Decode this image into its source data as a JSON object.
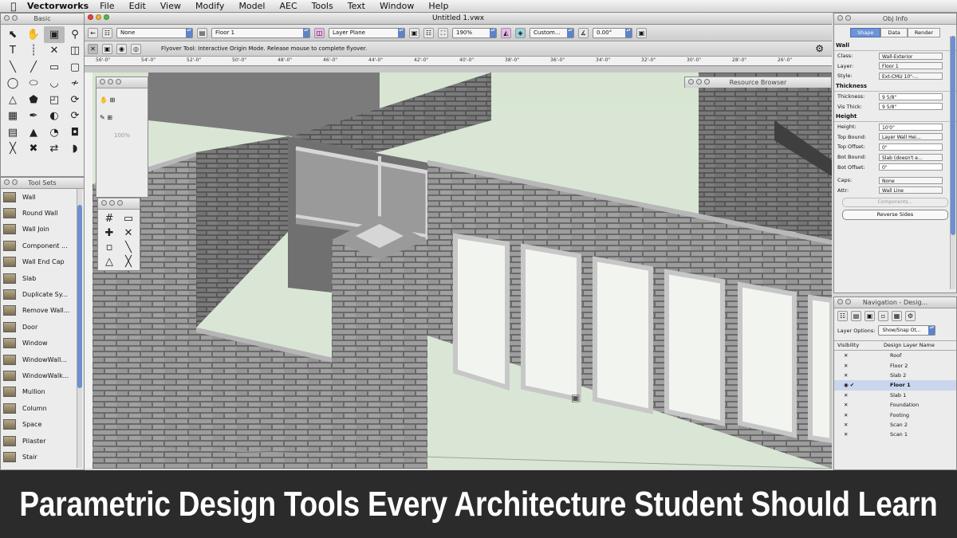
{
  "menubar": {
    "apple_icon": "apple-icon",
    "app_name": "Vectorworks",
    "items": [
      "File",
      "Edit",
      "View",
      "Modify",
      "Model",
      "AEC",
      "Tools",
      "Text",
      "Window",
      "Help"
    ]
  },
  "basic_palette": {
    "title": "Basic"
  },
  "tool_sets": {
    "title": "Tool Sets",
    "items": [
      {
        "label": "Wall",
        "icon": "wall-icon"
      },
      {
        "label": "Round Wall",
        "icon": "round-wall-icon"
      },
      {
        "label": "Wall Join",
        "icon": "wall-join-icon"
      },
      {
        "label": "Component ...",
        "icon": "component-icon"
      },
      {
        "label": "Wall End Cap",
        "icon": "wall-end-cap-icon"
      },
      {
        "label": "Slab",
        "icon": "slab-icon"
      },
      {
        "label": "Duplicate Sy...",
        "icon": "duplicate-symbol-icon"
      },
      {
        "label": "Remove Wall...",
        "icon": "remove-wall-icon"
      },
      {
        "label": "Door",
        "icon": "door-icon"
      },
      {
        "label": "Window",
        "icon": "window-icon"
      },
      {
        "label": "WindowWall...",
        "icon": "window-wall-icon"
      },
      {
        "label": "WindowWalk...",
        "icon": "window-walk-icon"
      },
      {
        "label": "Mullion",
        "icon": "mullion-icon"
      },
      {
        "label": "Column",
        "icon": "column-icon"
      },
      {
        "label": "Space",
        "icon": "space-icon"
      },
      {
        "label": "Pilaster",
        "icon": "pilaster-icon"
      },
      {
        "label": "Stair",
        "icon": "stair-icon"
      }
    ]
  },
  "document": {
    "title": "Untitled 1.vwx",
    "class_value": "None",
    "layer_value": "Floor 1",
    "layer_plane": "Layer Plane",
    "zoom": "190%",
    "view_value": "Custom...",
    "angle": "0.00°",
    "mode_text": "Flyover Tool: Interactive Origin Mode. Release mouse to complete flyover.",
    "ruler_ticks": [
      "56'-0\"",
      "54'-0\"",
      "52'-0\"",
      "50'-0\"",
      "48'-0\"",
      "46'-0\"",
      "44'-0\"",
      "42'-0\"",
      "40'-0\"",
      "38'-0\"",
      "36'-0\"",
      "34'-0\"",
      "32'-0\"",
      "30'-0\"",
      "28'-0\"",
      "26'-0\""
    ]
  },
  "resource_browser": {
    "title": "Resource Browser"
  },
  "floating_palette": {
    "zoom_value": "100%"
  },
  "obj_info": {
    "title": "Obj Info",
    "tabs": [
      "Shape",
      "Data",
      "Render"
    ],
    "object_type": "Wall",
    "rows": [
      {
        "label": "Class:",
        "value": "Wall-Exterior"
      },
      {
        "label": "Layer:",
        "value": "Floor 1"
      },
      {
        "label": "Style:",
        "value": "Ext-CMU 10\"-..."
      }
    ],
    "thickness_section": "Thickness",
    "thickness_rows": [
      {
        "label": "Thickness:",
        "value": "9 5/8\""
      },
      {
        "label": "Vis Thick:",
        "value": "9 5/8\""
      }
    ],
    "height_section": "Height",
    "height_rows": [
      {
        "label": "Height:",
        "value": "10'0\""
      },
      {
        "label": "Top Bound:",
        "value": "Layer Wall Hei..."
      },
      {
        "label": "Top Offset:",
        "value": "0\""
      },
      {
        "label": "Bot Bound:",
        "value": "Slab (doesn't e..."
      },
      {
        "label": "Bot Offset:",
        "value": "0\""
      }
    ],
    "caps_rows": [
      {
        "label": "Caps:",
        "value": "None"
      },
      {
        "label": "Attr:",
        "value": "Wall Line"
      }
    ],
    "components_button": "Components...",
    "reverse_sides_button": "Reverse Sides"
  },
  "navigation": {
    "title": "Navigation - Desig...",
    "layer_options_label": "Layer Options:",
    "layer_options_value": "Show/Snap Ot...",
    "col_visibility": "Visibility",
    "col_layer": "Design Layer Name",
    "layers": [
      "Roof",
      "Floor 2",
      "Slab 2",
      "Floor 1",
      "Slab 1",
      "Foundation",
      "Footing",
      "Scan 2",
      "Scan 1"
    ],
    "active_layer_index": 3
  },
  "banner": {
    "title": "Parametric Design Tools Every Architecture Student Should Learn"
  },
  "colors": {
    "accent": "#5d83c9",
    "banner_bg": "#2b2b2b",
    "banner_text": "#ffffff",
    "viewport_bg": "#d7e5d2"
  }
}
